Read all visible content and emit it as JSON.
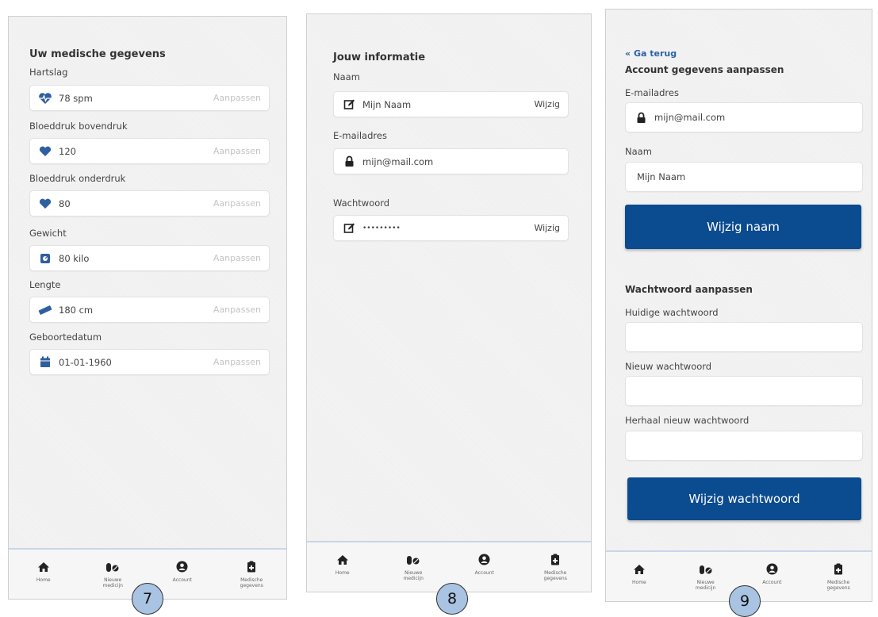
{
  "screen7": {
    "title": "Uw medische gegevens",
    "fields": [
      {
        "label": "Hartslag",
        "value": "78 spm",
        "action": "Aanpassen",
        "icon": "heartbeat-icon"
      },
      {
        "label": "Bloeddruk bovendruk",
        "value": "120",
        "action": "Aanpassen",
        "icon": "heart-icon"
      },
      {
        "label": "Bloeddruk onderdruk",
        "value": "80",
        "action": "Aanpassen",
        "icon": "heart-icon"
      },
      {
        "label": "Gewicht",
        "value": "80 kilo",
        "action": "Aanpassen",
        "icon": "weight-scale-icon"
      },
      {
        "label": "Lengte",
        "value": "180 cm",
        "action": "Aanpassen",
        "icon": "ruler-icon"
      },
      {
        "label": "Geboortedatum",
        "value": "01-01-1960",
        "action": "Aanpassen",
        "icon": "calendar-icon"
      }
    ],
    "badge": "7"
  },
  "screen8": {
    "title": "Jouw informatie",
    "name_label": "Naam",
    "name_value": "Mijn Naam",
    "name_action": "Wijzig",
    "email_label": "E-mailadres",
    "email_value": "mijn@mail.com",
    "password_label": "Wachtwoord",
    "password_value": "•••••••••",
    "password_action": "Wijzig",
    "badge": "8"
  },
  "screen9": {
    "back": "Ga terug",
    "title": "Account gegevens aanpassen",
    "email_label": "E-mailadres",
    "email_value": "mijn@mail.com",
    "name_label": "Naam",
    "name_value": "Mijn Naam",
    "change_name_button": "Wijzig naam",
    "password_title": "Wachtwoord aanpassen",
    "current_password_label": "Huidige wachtwoord",
    "new_password_label": "Nieuw wachtwoord",
    "repeat_password_label": "Herhaal nieuw wachtwoord",
    "change_password_button": "Wijzig wachtwoord",
    "badge": "9"
  },
  "nav": [
    {
      "label": "Home",
      "icon": "home-icon"
    },
    {
      "label": "Nieuwe medicijn",
      "icon": "pills-icon"
    },
    {
      "label": "Account",
      "icon": "user-circle-icon"
    },
    {
      "label": "Medische gegevens",
      "icon": "clipboard-icon"
    }
  ],
  "colors": {
    "primary": "#0b4b8f",
    "icon_blue": "#2f5f9e",
    "badge": "#a9c3e3",
    "muted_action": "#c4c4c4"
  }
}
